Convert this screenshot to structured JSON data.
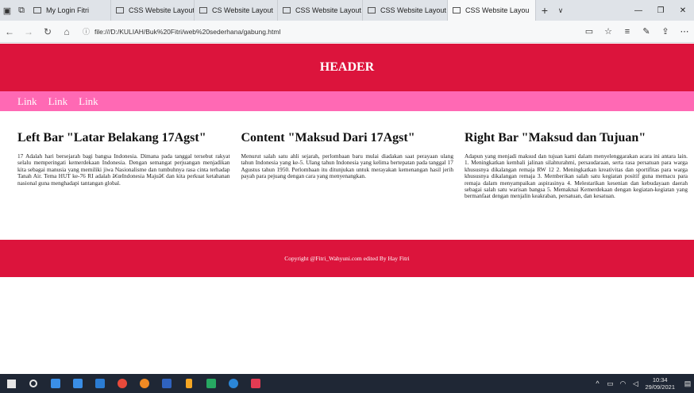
{
  "browser": {
    "tabs": [
      {
        "label": "My Login Fitri",
        "active": false
      },
      {
        "label": "CSS Website Layout",
        "active": false
      },
      {
        "label": "CS Website Layout",
        "active": false
      },
      {
        "label": "CSS Website Layout",
        "active": false
      },
      {
        "label": "CSS Website Layout",
        "active": false
      },
      {
        "label": "CSS Website Layou",
        "active": true
      }
    ],
    "close_glyph": "✕",
    "add_glyph": "+",
    "more_glyph": "∨",
    "address": "file:///D:/KULIAH/Buk%20Fitri/web%20sederhana/gabung.html"
  },
  "page": {
    "header": "HEADER",
    "nav_links": [
      "Link",
      "Link",
      "Link"
    ],
    "left": {
      "title": "Left Bar \"Latar Belakang 17Agst\"",
      "body": "17 Adalah hari bersejarah bagi bangsa Indonesia. Dimana pada tanggal tersebut rakyat selalu memperingati kemerdekaan Indonesia. Dengan semangat perjuangan menjadikan kita sebagai manusia yang memiliki jiwa Nasionalisme dan tumbuhnya rasa cinta terhadap Tanah Air. Tema HUT ke-76 RI adalah â€œIndonesia Majuâ€ dan kita perkuat ketahanan nasional guna menghadapi tantangan global."
    },
    "center": {
      "title": "Content \"Maksud Dari 17Agst\"",
      "body": "Menurut salah satu ahli sejarah, perlombaan baru mulai diadakan saat perayaan ulang tahun Indonesia yang ke-5. Ulang tahun Indonesia yang kelima bertepatan pada tanggal 17 Agustus tahun 1950. Perlombaan itu ditunjukan untuk merayakan kemenangan hasil jerih payah para pejuang dengan cara yang menyenangkan."
    },
    "right": {
      "title": "Right Bar \"Maksud dan Tujuan\"",
      "body": "Adapun yang menjadi maksud dan tujuan kami dalam menyelenggarakan acara ini antara lain. 1. Meningkatkan kembali jalinan silahturahmi, persaudaraan, serta rasa persatuan para warga khususnya dikalangan remaja RW 12 2. Meningkatkan kreativitas dan sportifitas para warga khususnya dikalangan remaja 3. Memberikan salah satu kegiatan positif guna memacu para remaja dalam menyampaikan aspirasinya 4. Melestarikan kesenian dan kebudayaan daerah sebagai salah satu warisan bangsa 5. Memaknai Kemerdekaan dengan kegiatan-kegiatan yang bermanfaat dengan menjalin keakraban, persatuan, dan kesatuan."
    },
    "footer": "Copyright @Fitri_Wahyuni.com edited By Hay Fitri"
  },
  "taskbar": {
    "time": "10:34",
    "date": "29/09/2021"
  },
  "colors": {
    "header": "#dc143c",
    "nav": "#ff69b4"
  }
}
